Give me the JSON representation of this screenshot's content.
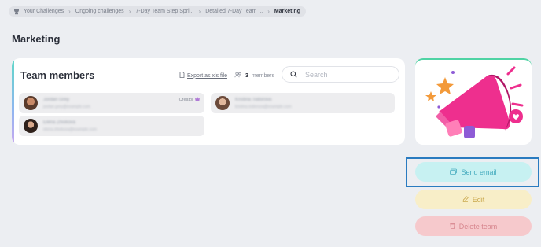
{
  "breadcrumb": {
    "items": [
      "Your Challenges",
      "Ongoing challenges",
      "7-Day Team Step Spri...",
      "Detailed 7-Day Team ...",
      "Marketing"
    ]
  },
  "page": {
    "title": "Marketing"
  },
  "team_card": {
    "title": "Team members",
    "export_label": "Export as xls file",
    "members_count": "3",
    "members_label": "members",
    "search_placeholder": "Search",
    "members": [
      {
        "name": "Jordan Grey",
        "email": "jordan.grey@example.com",
        "badge": "Creator"
      },
      {
        "name": "Kristina Todorova",
        "email": "kristina.todorova@example.com"
      },
      {
        "name": "Elena Zhivkova",
        "email": "elena.zhivkova@example.com"
      }
    ]
  },
  "actions": {
    "send_email": "Send email",
    "edit": "Edit",
    "delete_team": "Delete team"
  },
  "colors": {
    "accent_green": "#4fd3a4",
    "send_email_bg": "#c7f1f2",
    "edit_bg": "#f8eec8",
    "delete_bg": "#f6c9cc",
    "highlight": "#2a7bc0"
  }
}
